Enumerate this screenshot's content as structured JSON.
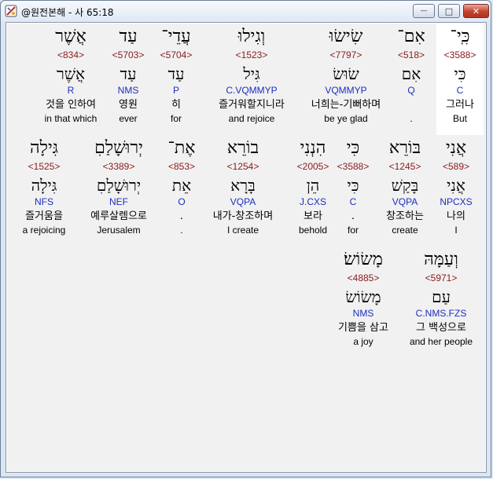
{
  "window": {
    "title": "@원전본해 - 사 65:18",
    "minimize": "—",
    "maximize": "□",
    "close": "✕",
    "icon": "app-icon"
  },
  "rows": [
    {
      "words": [
        {
          "heb": "כִּֽי־",
          "num": "<3588>",
          "lemma": "כִּי",
          "morph": "C",
          "kor": "그러나",
          "eng": "But"
        },
        {
          "heb": "אִם־",
          "num": "<518>",
          "lemma": "אִם",
          "morph": "Q",
          "kor": "",
          "eng": "."
        },
        {
          "heb": "שִׂישׂוּ",
          "num": "<7797>",
          "lemma": "שׂוּשׂ",
          "morph": "VQMMYP",
          "kor": "너희는-기뻐하며",
          "eng": "be ye glad"
        },
        {
          "heb": "וְגִילוּ",
          "num": "<1523>",
          "lemma": "גִּיל",
          "morph": "C.VQMMYP",
          "kor": "즐거워할지니라",
          "eng": "and rejoice"
        },
        {
          "heb": "עֲדֵי־",
          "num": "<5704>",
          "lemma": "עַד",
          "morph": "P",
          "kor": "히",
          "eng": "for"
        },
        {
          "heb": "עַד",
          "num": "<5703>",
          "lemma": "עַד",
          "morph": "NMS",
          "kor": "영원",
          "eng": "ever"
        },
        {
          "heb": "אֲשֶׁר",
          "num": "<834>",
          "lemma": "אֲשֶׁר",
          "morph": "R",
          "kor": "것을 인하여",
          "eng": "in that which"
        }
      ]
    },
    {
      "words": [
        {
          "heb": "אֲנִי",
          "num": "<589>",
          "lemma": "אֲנִי",
          "morph": "NPCXS",
          "kor": "나의",
          "eng": "I"
        },
        {
          "heb": "בּוֹרֵא",
          "num": "<1245>",
          "lemma": "בָּקַשׁ",
          "morph": "VQPA",
          "kor": "창조하는",
          "eng": "create"
        },
        {
          "heb": "כִּי",
          "num": "<3588>",
          "lemma": "כִּי",
          "morph": "C",
          "kor": ".",
          "eng": "for"
        },
        {
          "heb": "הִנְנִי",
          "num": "<2005>",
          "lemma": "הֵן",
          "morph": "J.CXS",
          "kor": "보라",
          "eng": "behold"
        },
        {
          "heb": "בוֹרֵא",
          "num": "<1254>",
          "lemma": "בָּרָא",
          "morph": "VQPA",
          "kor": "내가-창조하며",
          "eng": "I create"
        },
        {
          "heb": "אֶת־",
          "num": "<853>",
          "lemma": "אֵת",
          "morph": "O",
          "kor": ".",
          "eng": "."
        },
        {
          "heb": "יְרוּשָׁלַםִ",
          "num": "<3389>",
          "lemma": "יְרוּשָׁלַםִ",
          "morph": "NEF",
          "kor": "예루살렘으로",
          "eng": "Jerusalem"
        },
        {
          "heb": "גִּילָה",
          "num": "<1525>",
          "lemma": "גִּילָה",
          "morph": "NFS",
          "kor": "즐거움을",
          "eng": "a rejoicing"
        }
      ]
    },
    {
      "words": [
        {
          "heb": "וְעַמָּהּ",
          "num": "<5971>",
          "lemma": "עַם",
          "morph": "C.NMS.FZS",
          "kor": "그 백성으로",
          "eng": "and her people"
        },
        {
          "heb": "מָשׂוֹשׂ׃",
          "num": "<4885>",
          "lemma": "מָשׂוֹשׂ",
          "morph": "NMS",
          "kor": "기쁨을 삼고",
          "eng": "a joy"
        }
      ]
    }
  ]
}
